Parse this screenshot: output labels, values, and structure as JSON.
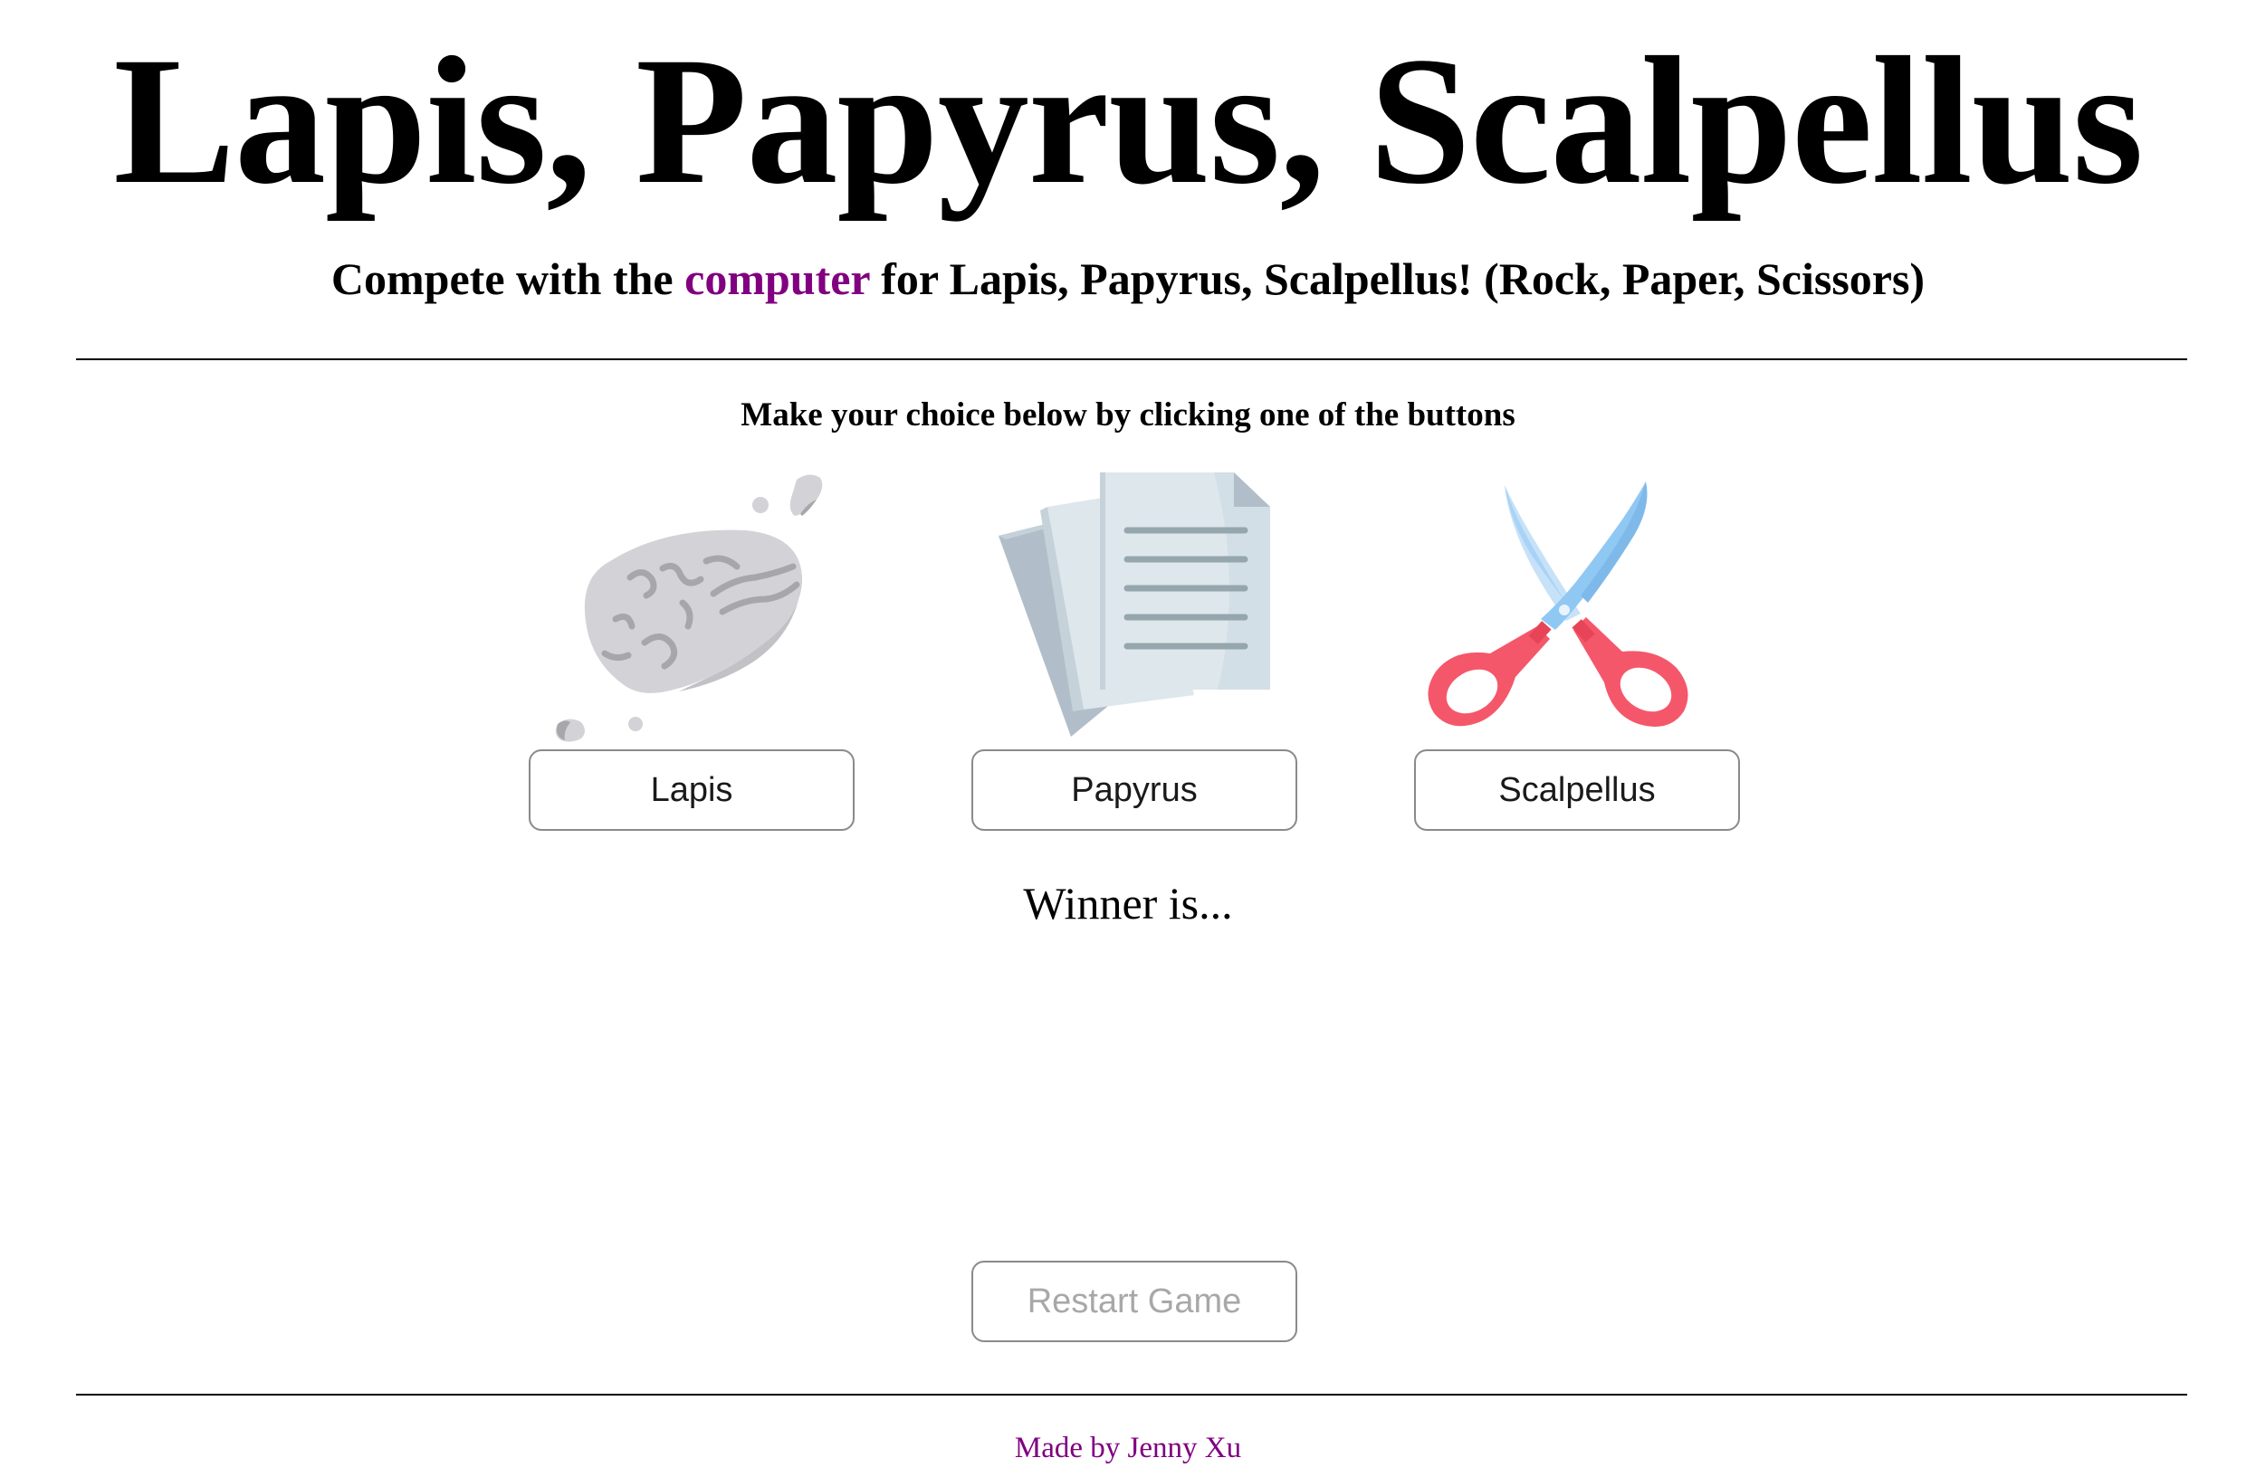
{
  "header": {
    "title": "Lapis, Papyrus, Scalpellus",
    "subtitle_before": "Compete with the ",
    "subtitle_link": "computer",
    "subtitle_after": " for Lapis, Papyrus, Scalpellus! (Rock, Paper, Scissors)"
  },
  "game": {
    "instructions": "Make your choice below by clicking one of the buttons",
    "choices": [
      {
        "label": "Lapis",
        "icon": "rock-icon"
      },
      {
        "label": "Papyrus",
        "icon": "paper-icon"
      },
      {
        "label": "Scalpellus",
        "icon": "scissors-icon"
      }
    ],
    "winner_text": "Winner is...",
    "restart_label": "Restart Game"
  },
  "footer": {
    "credit": "Made by Jenny Xu"
  },
  "colors": {
    "link": "#800080",
    "button_border": "#8a8a8a",
    "restart_disabled_text": "#a8a8a8",
    "rock_fill": "#d3d2d6",
    "rock_veins": "#a7a6ab",
    "paper_back": "#b1bec9",
    "paper_front": "#dde7ec",
    "paper_lines": "#96a6ad",
    "scissor_blade": "#90c8f4",
    "scissor_handle": "#f5576a"
  }
}
